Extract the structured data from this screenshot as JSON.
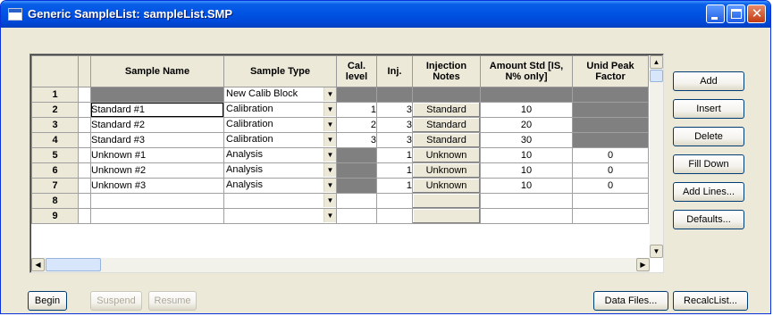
{
  "window": {
    "title": "Generic SampleList: sampleList.SMP"
  },
  "colors": {
    "titlebar": "#0054e3",
    "window_bg": "#ece9d8",
    "locked_cell": "#808080"
  },
  "grid": {
    "headers": [
      "",
      "",
      "Sample Name",
      "Sample Type",
      "Cal. level",
      "Inj.",
      "Injection Notes",
      "Amount Std [IS, N% only]",
      "Unid Peak Factor"
    ],
    "rows": [
      {
        "num": "1",
        "name": "",
        "type": "New Calib Block",
        "cal": "",
        "inj": "",
        "notes": "",
        "amount": "",
        "unid": ""
      },
      {
        "num": "2",
        "name": "Standard #1",
        "type": "Calibration",
        "cal": "1",
        "inj": "3",
        "notes": "Standard",
        "amount": "10",
        "unid": ""
      },
      {
        "num": "3",
        "name": "Standard #2",
        "type": "Calibration",
        "cal": "2",
        "inj": "3",
        "notes": "Standard",
        "amount": "20",
        "unid": ""
      },
      {
        "num": "4",
        "name": "Standard #3",
        "type": "Calibration",
        "cal": "3",
        "inj": "3",
        "notes": "Standard",
        "amount": "30",
        "unid": ""
      },
      {
        "num": "5",
        "name": "Unknown #1",
        "type": "Analysis",
        "cal": "",
        "inj": "1",
        "notes": "Unknown",
        "amount": "10",
        "unid": "0"
      },
      {
        "num": "6",
        "name": "Unknown #2",
        "type": "Analysis",
        "cal": "",
        "inj": "1",
        "notes": "Unknown",
        "amount": "10",
        "unid": "0"
      },
      {
        "num": "7",
        "name": "Unknown #3",
        "type": "Analysis",
        "cal": "",
        "inj": "1",
        "notes": "Unknown",
        "amount": "10",
        "unid": "0"
      },
      {
        "num": "8",
        "name": "",
        "type": "",
        "cal": "",
        "inj": "",
        "notes": "",
        "amount": "",
        "unid": ""
      },
      {
        "num": "9",
        "name": "",
        "type": "",
        "cal": "",
        "inj": "",
        "notes": "",
        "amount": "",
        "unid": ""
      }
    ]
  },
  "side_buttons": [
    "Add",
    "Insert",
    "Delete",
    "Fill Down",
    "Add Lines...",
    "Defaults..."
  ],
  "bottom_buttons": {
    "begin": "Begin",
    "suspend": "Suspend",
    "resume": "Resume",
    "data_files": "Data Files...",
    "recalc": "RecalcList..."
  }
}
